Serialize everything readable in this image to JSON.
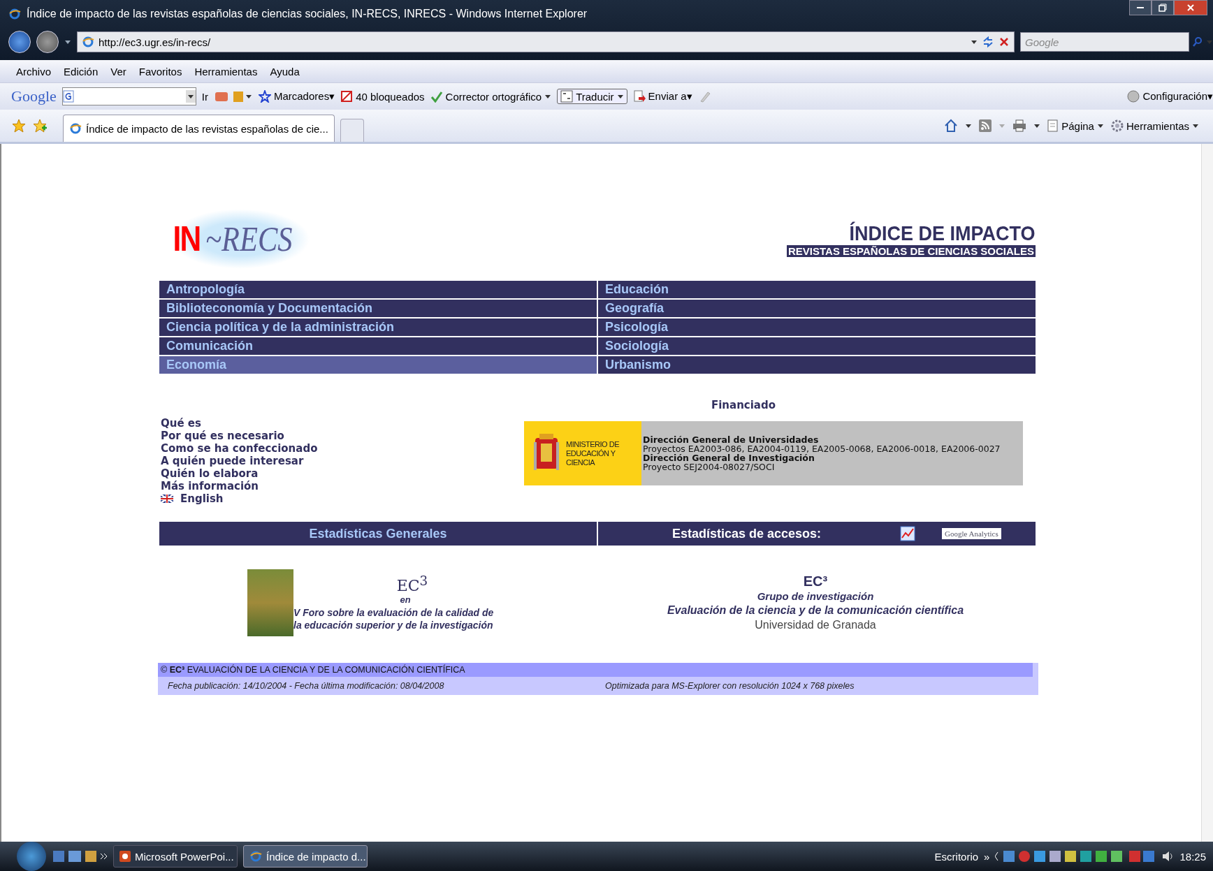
{
  "window": {
    "title": "Índice de impacto de las revistas españolas de ciencias sociales, IN-RECS, INRECS - Windows Internet Explorer"
  },
  "address_bar": {
    "url": "http://ec3.ugr.es/in-recs/"
  },
  "search": {
    "placeholder": "Google"
  },
  "menu": [
    "Archivo",
    "Edición",
    "Ver",
    "Favoritos",
    "Herramientas",
    "Ayuda"
  ],
  "google_toolbar": {
    "logo": "Google",
    "go": "Ir",
    "items": [
      {
        "label": "Marcadores▾",
        "kind": "star"
      },
      {
        "label": "40 bloqueados",
        "kind": "block"
      },
      {
        "label": "Corrector ortográfico",
        "kind": "spell"
      },
      {
        "label": "Traducir",
        "kind": "translate"
      },
      {
        "label": "Enviar a▾",
        "kind": "send"
      }
    ],
    "settings": "Configuración▾"
  },
  "tab": {
    "title": "Índice de impacto de las revistas españolas de cie..."
  },
  "command_bar": [
    "Página",
    "Herramientas"
  ],
  "site": {
    "logo_in": "IN",
    "logo_recs": "~RECS",
    "title": "ÍNDICE DE IMPACTO",
    "subtitle": "REVISTAS ESPAÑOLAS DE CIENCIAS SOCIALES"
  },
  "categories": [
    {
      "label": "Antropología",
      "selected": false
    },
    {
      "label": "Educación",
      "selected": false
    },
    {
      "label": "Biblioteconomía y Documentación",
      "selected": false
    },
    {
      "label": "Geografía",
      "selected": false
    },
    {
      "label": "Ciencia política y de la administración",
      "selected": false
    },
    {
      "label": "Psicología",
      "selected": false
    },
    {
      "label": "Comunicación",
      "selected": false
    },
    {
      "label": "Sociología",
      "selected": false
    },
    {
      "label": "Economía",
      "selected": true
    },
    {
      "label": "Urbanismo",
      "selected": false
    }
  ],
  "funding": {
    "heading": "Financiado",
    "ministry": "MINISTERIO DE EDUCACIÓN Y CIENCIA",
    "lines": [
      {
        "text": "Dirección General de Universidades",
        "kind": "bold"
      },
      {
        "text": "Proyectos EA2003-086, EA2004-0119, EA2005-0068, EA2006-0018, EA2006-0027",
        "kind": "plain"
      },
      {
        "text": "Dirección General de Investigación",
        "kind": "bold"
      },
      {
        "text": "Proyecto SEJ2004-08027/SOCI",
        "kind": "plain"
      }
    ]
  },
  "info_links": [
    {
      "label": "Qué es",
      "kind": "text"
    },
    {
      "label": "Por qué es necesario",
      "kind": "text"
    },
    {
      "label": "Como se ha confeccionado",
      "kind": "text"
    },
    {
      "label": "A quién puede interesar",
      "kind": "text"
    },
    {
      "label": "Quién lo elabora",
      "kind": "text"
    },
    {
      "label": "Más información",
      "kind": "text"
    },
    {
      "label": "English",
      "kind": "flag"
    }
  ],
  "stats": {
    "general": "Estadísticas Generales",
    "access": "Estadísticas de accesos:",
    "analytics": "Google Analytics"
  },
  "forum": {
    "ec3": "EC$^{3}$",
    "en": "en",
    "text": "V Foro sobre la evaluación de la calidad de la educación superior y de la investigación"
  },
  "group": {
    "ec3": "EC³",
    "lines": [
      "Grupo de investigación",
      "Evaluación de la ciencia y de la comunicación científica"
    ],
    "university": "Universidad de Granada"
  },
  "footer": {
    "copyright": "© **EC³** EVALUACIÓN DE LA CIENCIA Y DE LA COMUNICACIÓN CIENTÍFICA",
    "dates": "Fecha publicación: 14/10/2004 - Fecha última modificación: 08/04/2008",
    "optimized": "Optimizada para MS-Explorer con resolución 1024 x 768 pixeles"
  },
  "taskbar": {
    "tasks": [
      {
        "label": "Microsoft PowerPoi...",
        "selected": false
      },
      {
        "label": "Índice de impacto d...",
        "selected": true
      }
    ],
    "desktop": "Escritorio",
    "more": "»",
    "clock": "18:25"
  }
}
